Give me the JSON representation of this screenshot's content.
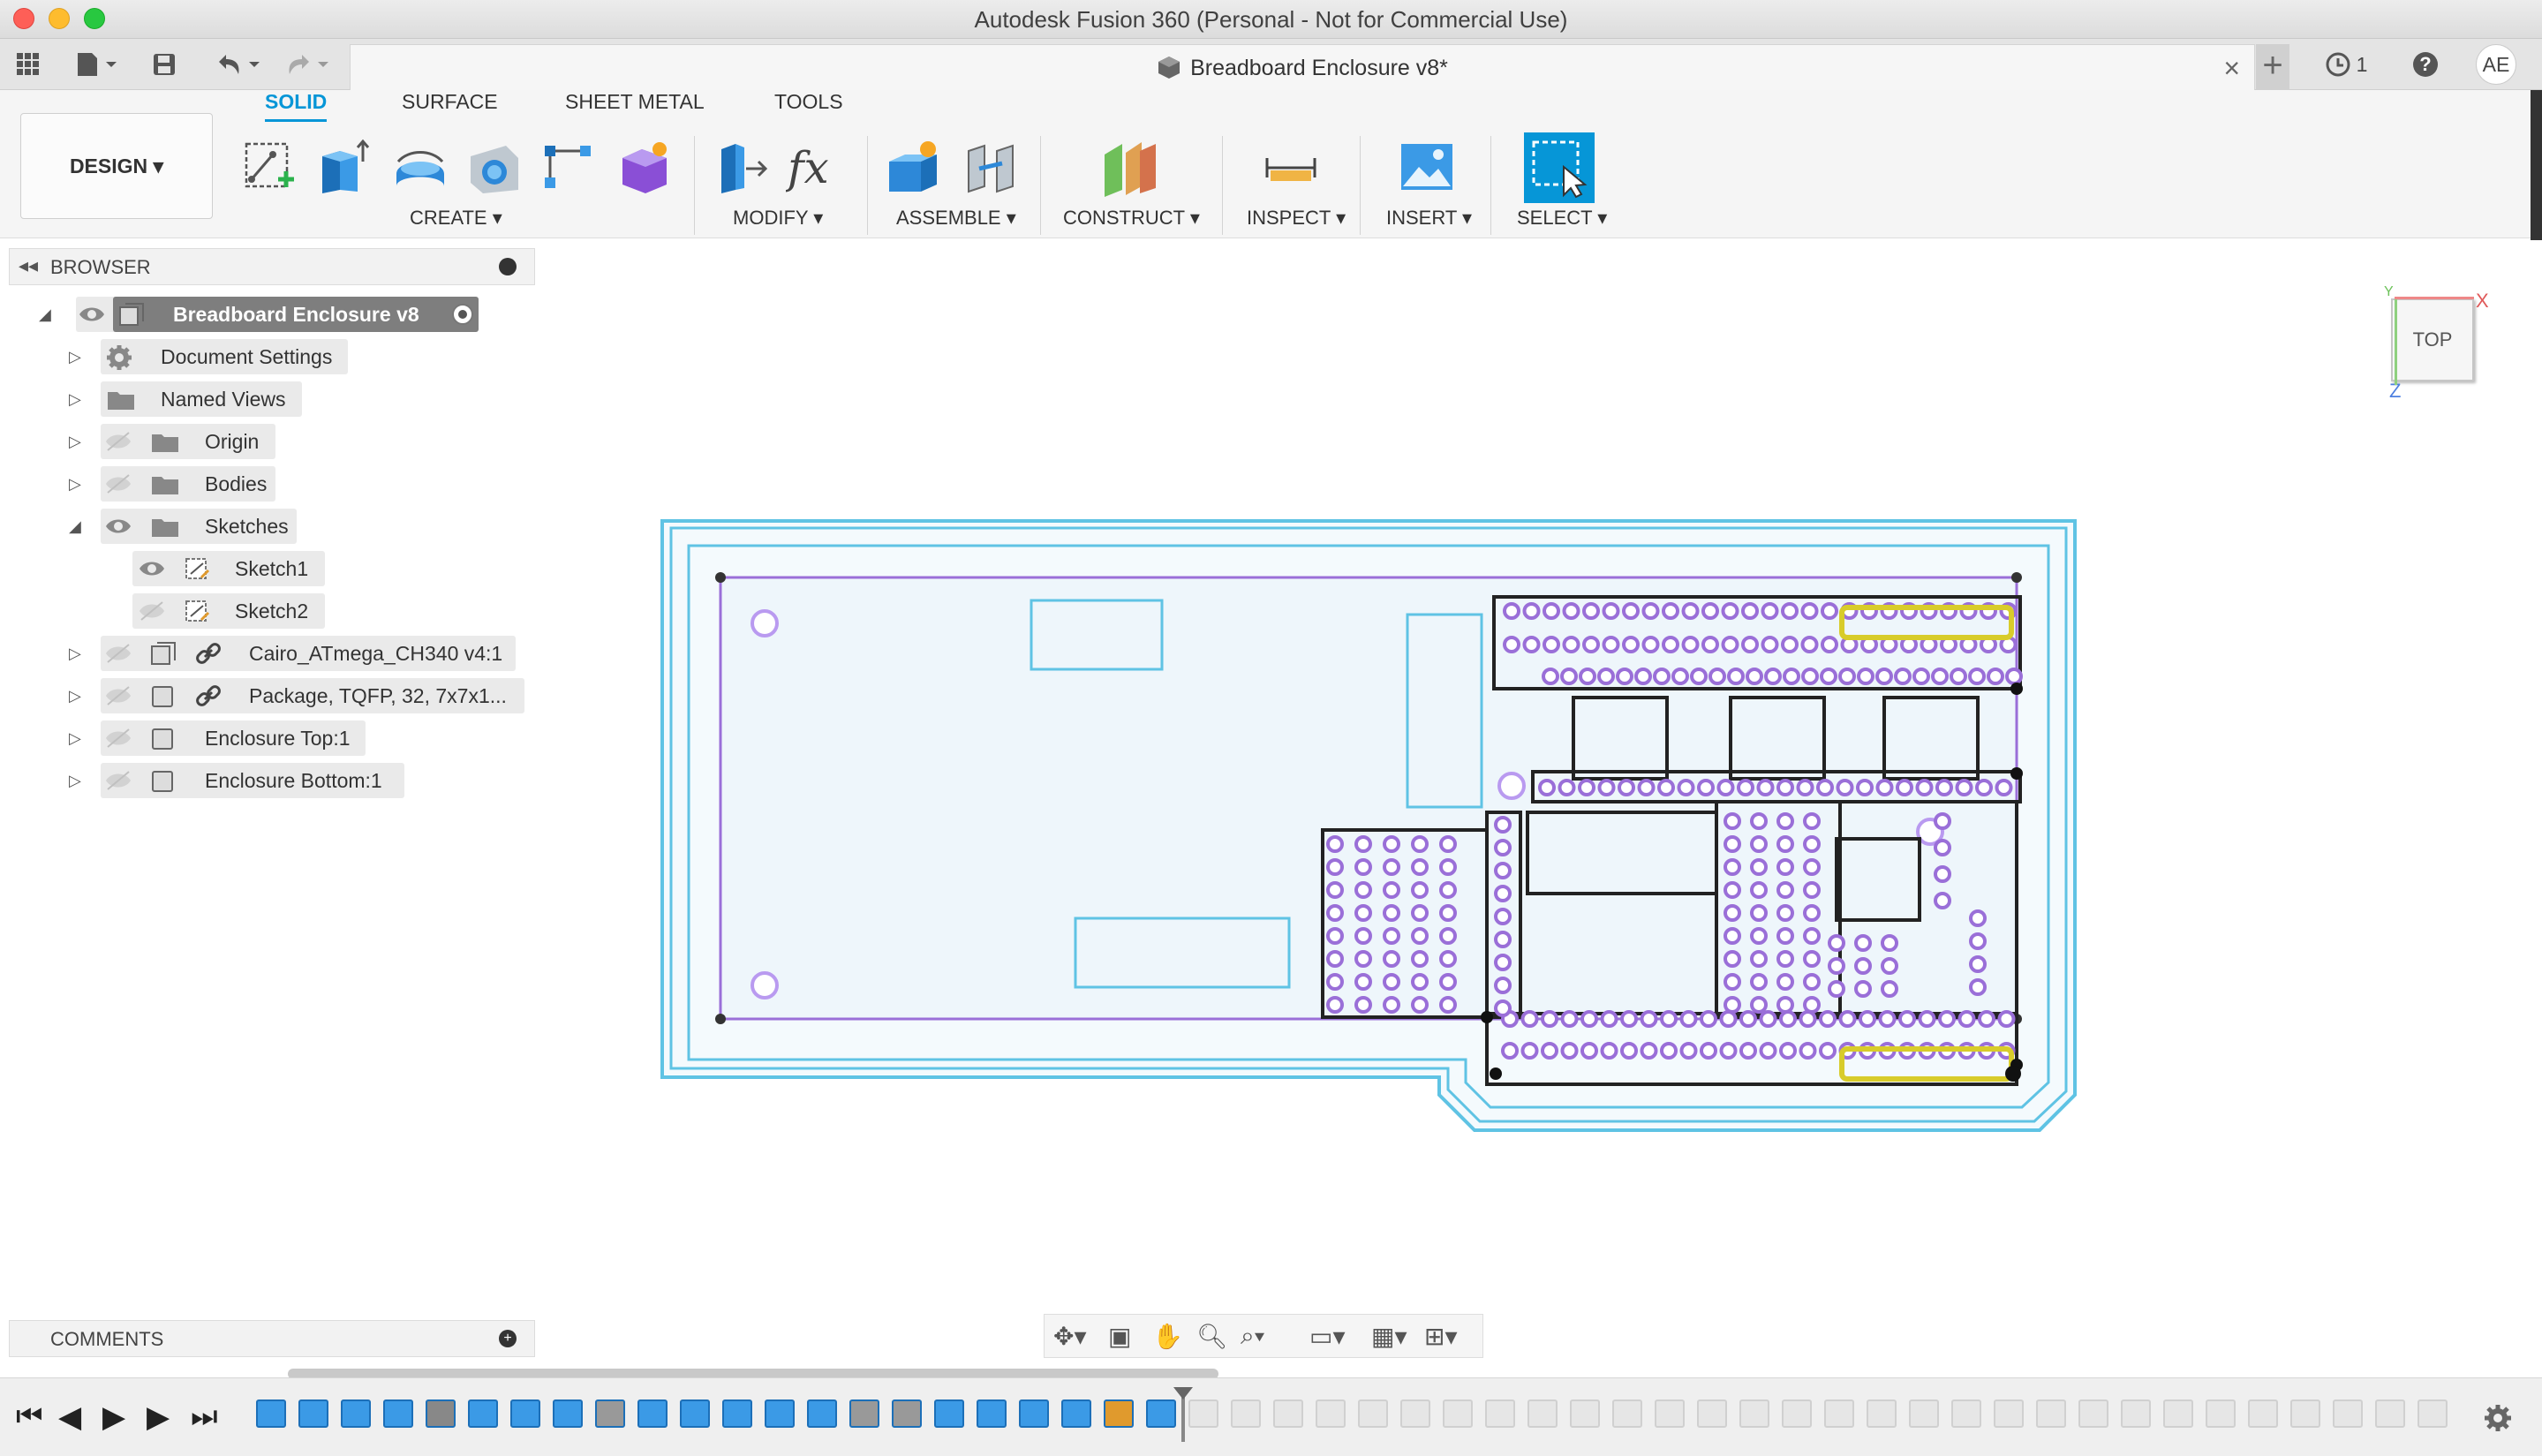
{
  "window": {
    "title": "Autodesk Fusion 360 (Personal - Not for Commercial Use)"
  },
  "appbar": {
    "doc_tab_title": "Breadboard Enclosure v8*",
    "job_count": "1",
    "help": "?",
    "user_initials": "AE"
  },
  "toolbar": {
    "workspace": "DESIGN ▾",
    "tabs": [
      "SOLID",
      "SURFACE",
      "SHEET METAL",
      "TOOLS"
    ],
    "groups": [
      "CREATE ▾",
      "MODIFY ▾",
      "ASSEMBLE ▾",
      "CONSTRUCT ▾",
      "INSPECT ▾",
      "INSERT ▾",
      "SELECT ▾"
    ]
  },
  "browser": {
    "title": "BROWSER",
    "items": [
      {
        "label": "Breadboard Enclosure v8"
      },
      {
        "label": "Document Settings"
      },
      {
        "label": "Named Views"
      },
      {
        "label": "Origin"
      },
      {
        "label": "Bodies"
      },
      {
        "label": "Sketches"
      },
      {
        "label": "Sketch1"
      },
      {
        "label": "Sketch2"
      },
      {
        "label": "Cairo_ATmega_CH340 v4:1"
      },
      {
        "label": "Package, TQFP, 32, 7x7x1..."
      },
      {
        "label": "Enclosure Top:1"
      },
      {
        "label": "Enclosure Bottom:1"
      }
    ]
  },
  "viewcube": {
    "face": "TOP",
    "axis_x": "X",
    "axis_y": "Y",
    "axis_z": "Z"
  },
  "comments": {
    "title": "COMMENTS"
  },
  "colors": {
    "accent": "#0696d7",
    "sketch_outline": "#5fc3e4",
    "pcb_fill": "#eef6fb",
    "pad": "#9a6fd8",
    "highlight": "#d8cc2a"
  }
}
